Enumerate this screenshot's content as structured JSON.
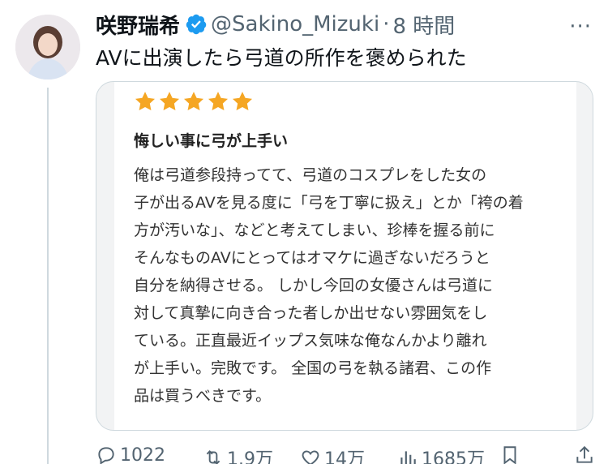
{
  "tweet": {
    "author_name": "咲野瑞希",
    "handle": "@Sakino_Mizuki",
    "separator": "·",
    "time": "8 時間",
    "more": "···",
    "text": "AVに出演したら弓道の所作を褒められた"
  },
  "review": {
    "stars": 5,
    "star_color": "#f5a623",
    "title": "悔しい事に弓が上手い",
    "lines": [
      "俺は弓道参段持ってて、弓道のコスプレをした女の",
      "子が出るAVを見る度に「弓を丁寧に扱え」とか「袴の着",
      "方が汚いな」、などと考えてしまい、珍棒を握る前に",
      "そんなものAVにとってはオマケに過ぎないだろうと",
      "自分を納得させる。 しかし今回の女優さんは弓道に",
      "対して真摯に向き合った者しか出せない雰囲気をし",
      "ている。正直最近イップス気味な俺なんかより離れ",
      "が上手い。完敗です。 全国の弓を執る諸君、この作",
      "品は買うべきです。"
    ]
  },
  "actions": {
    "replies": "1022",
    "retweets": "1.9万",
    "likes": "14万",
    "views": "1685万"
  },
  "colors": {
    "verified": "#1d9bf0",
    "muted": "#536471"
  },
  "icons": [
    "verified-badge-icon",
    "star-icon",
    "reply-icon",
    "retweet-icon",
    "like-icon",
    "views-icon",
    "bookmark-icon",
    "share-icon"
  ]
}
